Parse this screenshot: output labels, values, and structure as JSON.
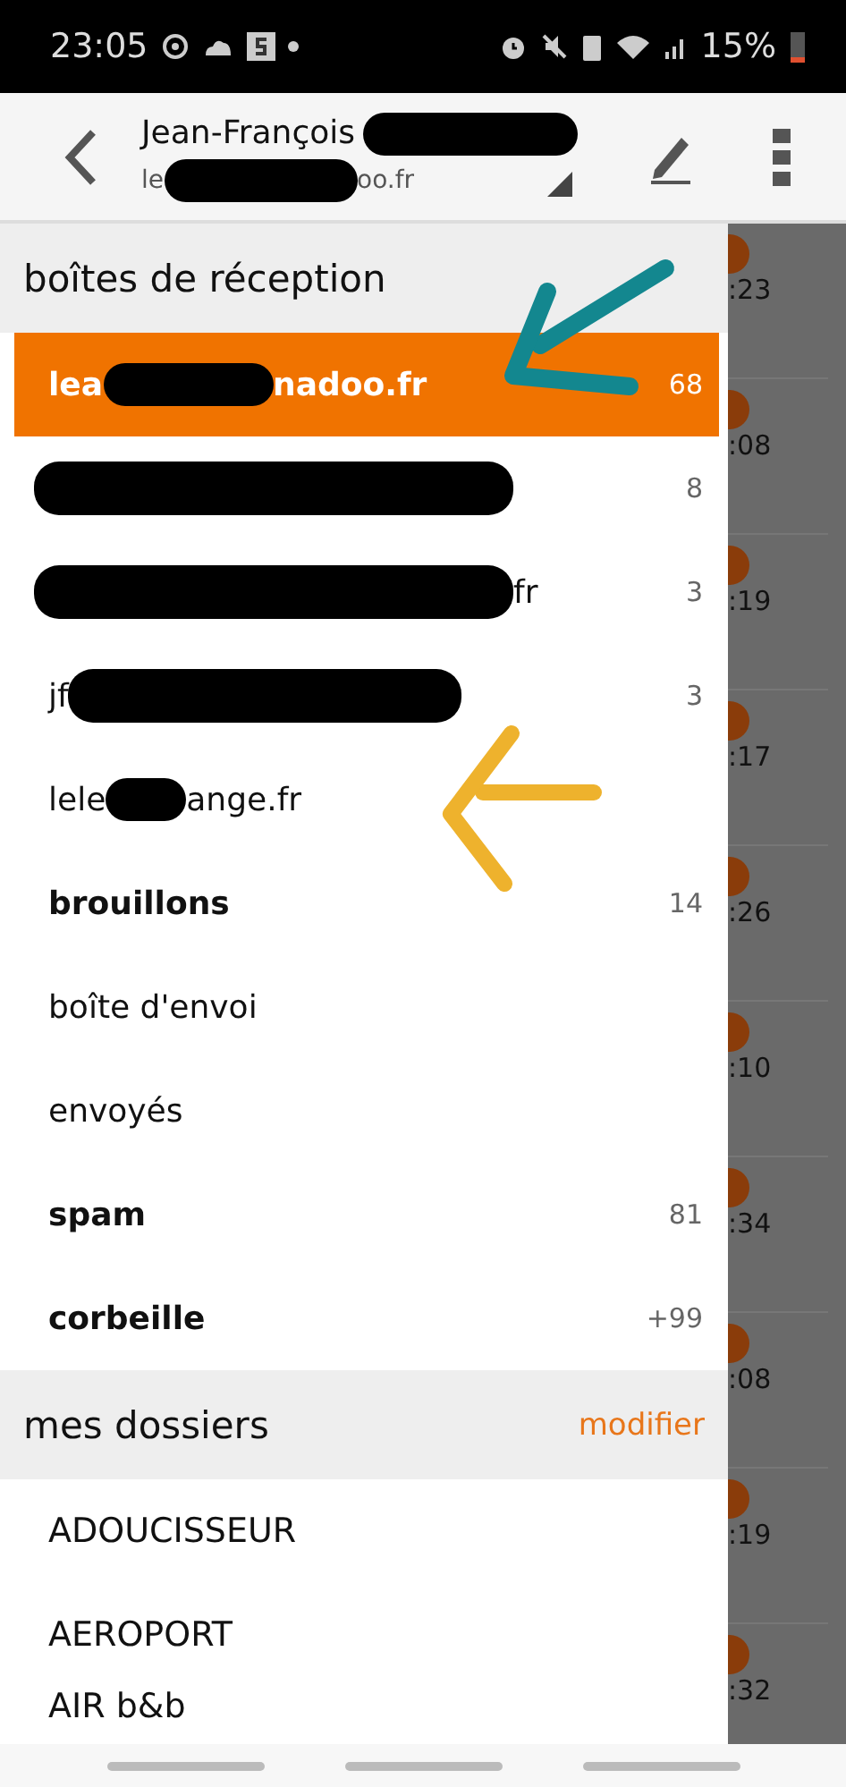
{
  "status_bar": {
    "time": "23:05",
    "battery": "15%"
  },
  "header": {
    "title": "Jean-François",
    "subtitle_start": "le",
    "subtitle_end": "oo.fr"
  },
  "inboxes": {
    "title": "boîtes de réception",
    "accounts": [
      {
        "start": "lea",
        "end": "nadoo.fr",
        "count": "68",
        "selected": true
      },
      {
        "count": "8",
        "selected": false
      },
      {
        "end": "fr",
        "count": "3",
        "selected": false
      },
      {
        "start": "jf",
        "count": "3",
        "selected": false
      },
      {
        "start": "lele",
        "end": "ange.fr",
        "selected": false
      }
    ]
  },
  "folders": [
    {
      "label": "brouillons",
      "count": "14",
      "bold": true
    },
    {
      "label": "boîte d'envoi",
      "bold": false
    },
    {
      "label": "envoyés",
      "bold": false
    },
    {
      "label": "spam",
      "count": "81",
      "bold": true
    },
    {
      "label": "corbeille",
      "count": "+99",
      "bold": true
    }
  ],
  "my_folders": {
    "title": "mes dossiers",
    "action": "modifier",
    "items": [
      "ADOUCISSEUR",
      "AEROPORT",
      "AIR b&b"
    ]
  },
  "background_times": [
    ":23",
    ":08",
    ":19",
    ":17",
    ":26",
    ":10",
    ":34",
    ":08",
    ":19",
    ":32"
  ]
}
